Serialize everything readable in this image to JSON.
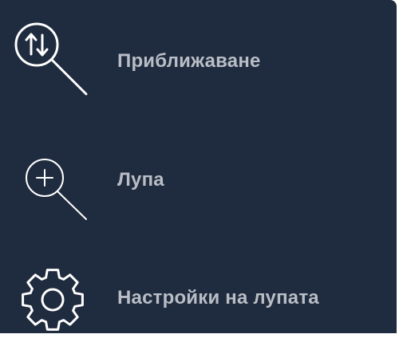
{
  "menu": {
    "items": [
      {
        "label": "Приближаване",
        "icon": "zoom-updown-icon"
      },
      {
        "label": "Лупа",
        "icon": "magnifier-plus-icon"
      },
      {
        "label": "Настройки на лупата",
        "icon": "gear-icon"
      }
    ]
  },
  "colors": {
    "panel_background": "#1f2b3e",
    "label_text": "#b9bec6",
    "icon_stroke": "#ffffff"
  }
}
